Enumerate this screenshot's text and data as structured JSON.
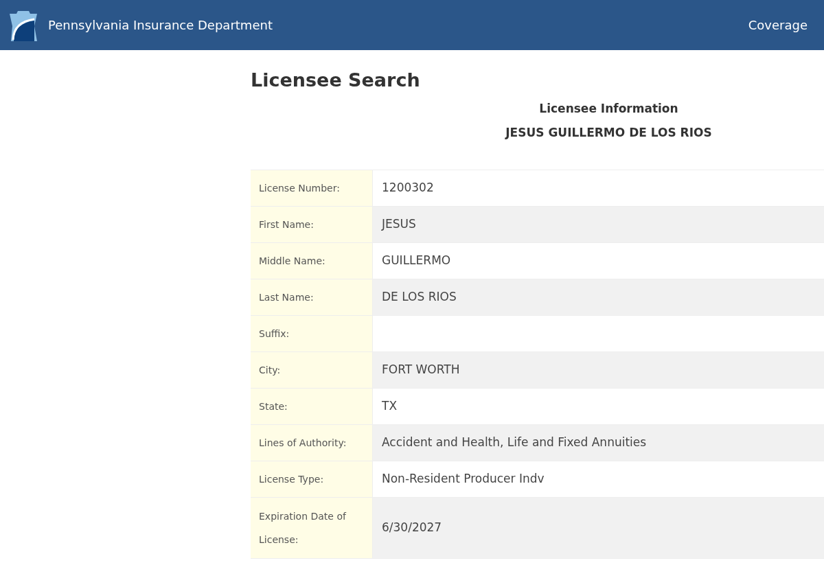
{
  "header": {
    "title": "Pennsylvania Insurance Department",
    "nav_link": "Coverage"
  },
  "page_title": "Licensee Search",
  "section_title": "Licensee Information",
  "licensee_name": "JESUS GUILLERMO DE LOS RIOS",
  "rows": [
    {
      "label": "License Number:",
      "value": "1200302"
    },
    {
      "label": "First Name:",
      "value": "JESUS"
    },
    {
      "label": "Middle Name:",
      "value": "GUILLERMO"
    },
    {
      "label": "Last Name:",
      "value": "DE LOS RIOS"
    },
    {
      "label": "Suffix:"
    },
    {
      "label": "City:",
      "value": "FORT WORTH"
    },
    {
      "label": "State:",
      "value": "TX"
    },
    {
      "label": "Lines of Authority:",
      "value": "Accident and Health, Life and Fixed Annuities"
    },
    {
      "label": "License Type:",
      "value": "Non-Resident Producer Indv"
    },
    {
      "label": "Expiration Date of License:",
      "value": "6/30/2027"
    }
  ]
}
